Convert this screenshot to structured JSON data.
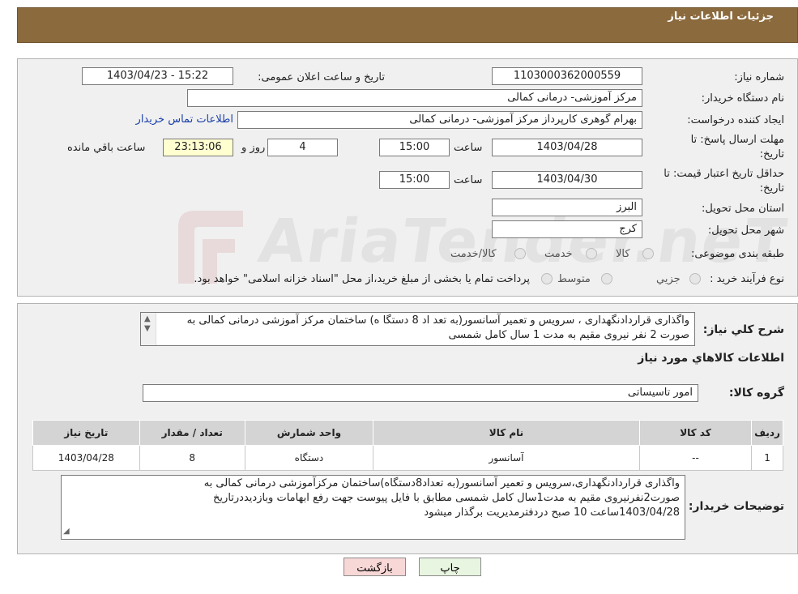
{
  "header": {
    "title": "جزئیات اطلاعات نیاز"
  },
  "info": {
    "need_number_label": "شماره نیاز:",
    "need_number": "1103000362000559",
    "announce_label": "تاریخ و ساعت اعلان عمومی:",
    "announce_value": "1403/04/23 - 15:22",
    "buyer_org_label": "نام دستگاه خریدار:",
    "buyer_org": "مرکز آموزشی- درمانی کمالی",
    "creator_label": "ایجاد کننده درخواست:",
    "creator": "بهرام گوهری کارپرداز مرکز آموزشی- درمانی کمالی",
    "contact_link": "اطلاعات تماس خریدار",
    "deadline_label_1": "مهلت ارسال پاسخ: تا",
    "deadline_label_2": "تاریخ:",
    "deadline_date": "1403/04/28",
    "time_label": "ساعت",
    "deadline_time": "15:00",
    "days_value": "4",
    "days_label": "روز و",
    "remaining_time": "23:13:06",
    "remaining_label": "ساعت باقي مانده",
    "validity_label_1": "حداقل تاریخ اعتبار قیمت: تا",
    "validity_label_2": "تاریخ:",
    "validity_date": "1403/04/30",
    "validity_time": "15:00",
    "province_label": "استان محل تحویل:",
    "province": "البرز",
    "city_label": "شهر محل تحویل:",
    "city": "کرج",
    "category_label": "طبقه بندی موضوعی:",
    "category_options": [
      "کالا",
      "خدمت",
      "کالا/خدمت"
    ],
    "process_label": "نوع فرآیند خرید :",
    "process_options": [
      "جزیي",
      "متوسط"
    ],
    "process_note": "پرداخت تمام یا بخشی از مبلغ خرید،از محل \"اسناد خزانه اسلامی\" خواهد بود."
  },
  "description": {
    "label": "شرح کلي نياز:",
    "text": "واگذاری قراردادنگهداری ، سرویس و تعمیر آسانسور(به تعد اد 8 دستگا ه) ساختمان مرکز آموزشی درمانی کمالی به صورت 2 نفر نیروی مقیم به مدت 1 سال کامل شمسی"
  },
  "goods": {
    "section_title": "اطلاعات کالاهاي مورد نياز",
    "group_label": "گروه کالا:",
    "group_value": "امور تاسیساتی",
    "columns": [
      "ردیف",
      "کد کالا",
      "نام کالا",
      "واحد شمارش",
      "تعداد / مقدار",
      "تاریخ نیاز"
    ],
    "rows": [
      [
        "1",
        "--",
        "آسانسور",
        "دستگاه",
        "8",
        "1403/04/28"
      ]
    ]
  },
  "buyer_notes": {
    "label": "توضیحات خریدار:",
    "line1": "واگذاری قراردادنگهداری،سرویس و تعمیر آسانسور(به تعداد8دستگاه)ساختمان مرکزآموزشی درمانی کمالی به",
    "line2": "صورت2نفرنیروی مقیم به مدت1سال کامل شمسی مطابق با فایل پیوست جهت رفع ابهامات وبازدیددرتاریخ",
    "line3": "1403/04/28ساعت 10 صبح دردفترمدیریت برگذار میشود"
  },
  "buttons": {
    "print": "چاپ",
    "back": "بازگشت"
  },
  "watermark": {
    "text": "AriaTender.neT"
  },
  "colors": {
    "header": "#8b6a3d",
    "back_button": "#f8d7d7",
    "print_button": "#e8f5e0",
    "link": "#1a3fa8"
  }
}
